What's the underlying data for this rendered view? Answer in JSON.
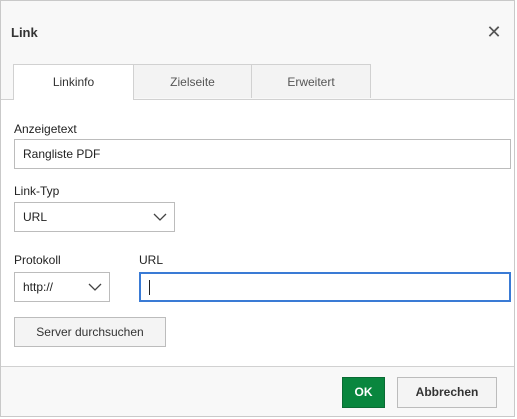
{
  "dialog": {
    "title": "Link",
    "close_icon": "close-icon"
  },
  "tabs": [
    {
      "label": "Linkinfo",
      "active": true
    },
    {
      "label": "Zielseite",
      "active": false
    },
    {
      "label": "Erweitert",
      "active": false
    }
  ],
  "form": {
    "display_text_label": "Anzeigetext",
    "display_text_value": "Rangliste PDF",
    "link_type_label": "Link-Typ",
    "link_type_value": "URL",
    "protocol_label": "Protokoll",
    "protocol_value": "http://",
    "url_label": "URL",
    "url_value": "",
    "browse_server_label": "Server durchsuchen"
  },
  "footer": {
    "ok_label": "OK",
    "cancel_label": "Abbrechen"
  },
  "colors": {
    "ok_button": "#09863e",
    "focus_border": "#3a7bd5"
  }
}
